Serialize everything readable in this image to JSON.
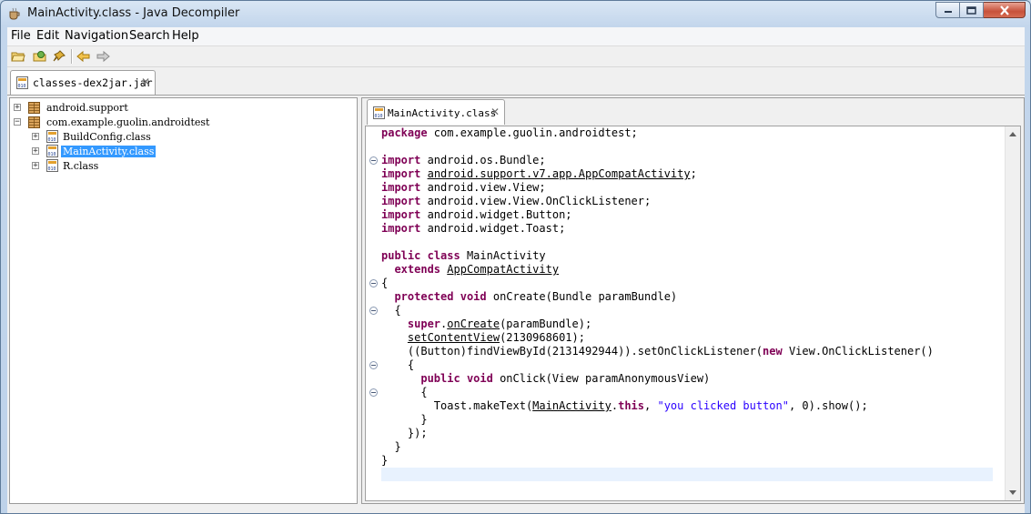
{
  "window": {
    "title": "MainActivity.class - Java Decompiler"
  },
  "menu": {
    "items": [
      "File",
      "Edit",
      "Navigation",
      "Search",
      "Help"
    ]
  },
  "toolbar": {
    "icons": [
      "open-file-icon",
      "open-type-icon",
      "search-pin-icon",
      "back-arrow-icon",
      "forward-arrow-icon"
    ]
  },
  "outer_tab": {
    "label": "classes-dex2jar.jar"
  },
  "tree": {
    "nodes": [
      {
        "label": "android.support",
        "kind": "package",
        "expander": "+"
      },
      {
        "label": "com.example.guolin.androidtest",
        "kind": "package",
        "expander": "−"
      },
      {
        "label": "BuildConfig.class",
        "kind": "class",
        "expander": "+"
      },
      {
        "label": "MainActivity.class",
        "kind": "class",
        "expander": "+",
        "selected": true
      },
      {
        "label": "R.class",
        "kind": "class",
        "expander": "+"
      }
    ]
  },
  "editor_tab": {
    "label": "MainActivity.class"
  },
  "colors": {
    "keyword": "#7f0055",
    "string": "#2a00ff",
    "selection": "#3399ff",
    "current_line": "#e8f2fe"
  },
  "code": {
    "lines": [
      [
        {
          "t": "package",
          "k": "kw"
        },
        {
          "t": " com.example.guolin.androidtest;"
        }
      ],
      [],
      [
        {
          "t": "import",
          "k": "kw"
        },
        {
          "t": " android.os.Bundle;"
        }
      ],
      [
        {
          "t": "import",
          "k": "kw"
        },
        {
          "t": " "
        },
        {
          "t": "android.support.v7.app.AppCompatActivity",
          "k": "u"
        },
        {
          "t": ";"
        }
      ],
      [
        {
          "t": "import",
          "k": "kw"
        },
        {
          "t": " android.view.View;"
        }
      ],
      [
        {
          "t": "import",
          "k": "kw"
        },
        {
          "t": " android.view.View.OnClickListener;"
        }
      ],
      [
        {
          "t": "import",
          "k": "kw"
        },
        {
          "t": " android.widget.Button;"
        }
      ],
      [
        {
          "t": "import",
          "k": "kw"
        },
        {
          "t": " android.widget.Toast;"
        }
      ],
      [],
      [
        {
          "t": "public",
          "k": "kw"
        },
        {
          "t": " "
        },
        {
          "t": "class",
          "k": "kw"
        },
        {
          "t": " MainActivity"
        }
      ],
      [
        {
          "t": "  "
        },
        {
          "t": "extends",
          "k": "kw"
        },
        {
          "t": " "
        },
        {
          "t": "AppCompatActivity",
          "k": "u"
        }
      ],
      [
        {
          "t": "{"
        }
      ],
      [
        {
          "t": "  "
        },
        {
          "t": "protected",
          "k": "kw"
        },
        {
          "t": " "
        },
        {
          "t": "void",
          "k": "kw"
        },
        {
          "t": " onCreate(Bundle paramBundle)"
        }
      ],
      [
        {
          "t": "  {"
        }
      ],
      [
        {
          "t": "    "
        },
        {
          "t": "super",
          "k": "kw"
        },
        {
          "t": "."
        },
        {
          "t": "onCreate",
          "k": "u"
        },
        {
          "t": "(paramBundle);"
        }
      ],
      [
        {
          "t": "    "
        },
        {
          "t": "setContentView",
          "k": "u"
        },
        {
          "t": "(2130968601);"
        }
      ],
      [
        {
          "t": "    ((Button)findViewById(2131492944)).setOnClickListener("
        },
        {
          "t": "new",
          "k": "kw"
        },
        {
          "t": " View.OnClickListener()"
        }
      ],
      [
        {
          "t": "    {"
        }
      ],
      [
        {
          "t": "      "
        },
        {
          "t": "public",
          "k": "kw"
        },
        {
          "t": " "
        },
        {
          "t": "void",
          "k": "kw"
        },
        {
          "t": " onClick(View paramAnonymousView)"
        }
      ],
      [
        {
          "t": "      {"
        }
      ],
      [
        {
          "t": "        Toast.makeText("
        },
        {
          "t": "MainActivity",
          "k": "u"
        },
        {
          "t": "."
        },
        {
          "t": "this",
          "k": "kw"
        },
        {
          "t": ", "
        },
        {
          "t": "\"you clicked button\"",
          "k": "str"
        },
        {
          "t": ", 0).show();"
        }
      ],
      [
        {
          "t": "      }"
        }
      ],
      [
        {
          "t": "    });"
        }
      ],
      [
        {
          "t": "  }"
        }
      ],
      [
        {
          "t": "}"
        }
      ],
      []
    ],
    "fold_lines": [
      2,
      11,
      13,
      17,
      19
    ]
  }
}
